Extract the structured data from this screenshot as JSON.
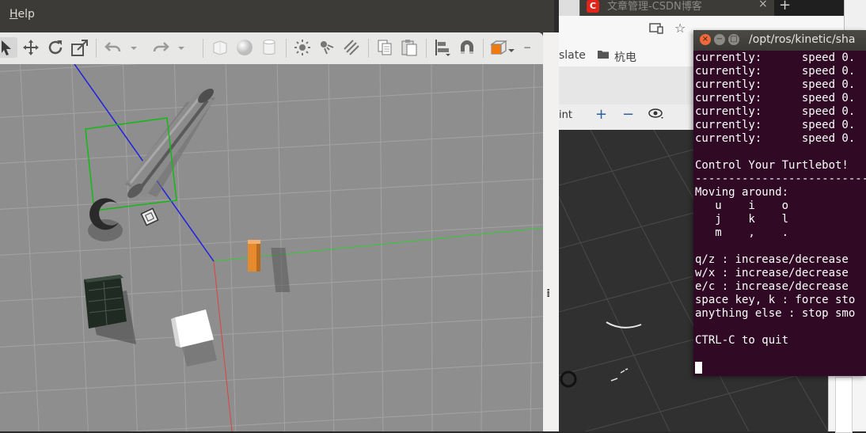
{
  "gazebo": {
    "menu": {
      "help_label": "Help",
      "help_mnemonic": "H",
      "help_rest": "elp"
    },
    "toolbar": {
      "tools": [
        "select-arrow",
        "translate-arrows",
        "rotate",
        "scale",
        "undo",
        "undo-dropdown",
        "redo",
        "redo-dropdown",
        "box-shape",
        "sphere-shape",
        "cylinder-shape",
        "point-light",
        "spot-light",
        "directional-light",
        "copy",
        "paste",
        "align",
        "snap-magnet",
        "view-angle",
        "view-angle-dropdown"
      ]
    },
    "viewport": {
      "background": "#8e8e8e",
      "grid_color": "#a6a6a6",
      "selection_color": "#00c000",
      "axis_colors": {
        "x": "#ff3030",
        "y": "#33cc33",
        "z": "#2020ff"
      }
    },
    "splitter_grip": "⁞"
  },
  "browser": {
    "tab_title": "文章管理-CSDN博客",
    "tab_favicon": "C",
    "tab_close": "×",
    "new_tab": "+",
    "bookmarks": [
      {
        "label": "slate"
      },
      {
        "label": "杭电"
      }
    ],
    "rviz": {
      "toolbar_text": "int",
      "zoom_plus": "+",
      "zoom_minus": "−"
    },
    "accent": "#e1251b"
  },
  "terminal": {
    "title": "/opt/ros/kinetic/sha",
    "close_glyph": "×",
    "min_glyph": "−",
    "max_glyph": "□",
    "lines": [
      "currently:      speed 0.",
      "currently:      speed 0.",
      "currently:      speed 0.",
      "currently:      speed 0.",
      "currently:      speed 0.",
      "currently:      speed 0.",
      "currently:      speed 0.",
      "",
      "Control Your Turtlebot!",
      "---------------------------",
      "Moving around:",
      "   u    i    o",
      "   j    k    l",
      "   m    ,    .",
      "",
      "q/z : increase/decrease",
      "w/x : increase/decrease",
      "e/c : increase/decrease",
      "space key, k : force sto",
      "anything else : stop smo",
      "",
      "CTRL-C to quit"
    ],
    "background": "#300a24"
  }
}
